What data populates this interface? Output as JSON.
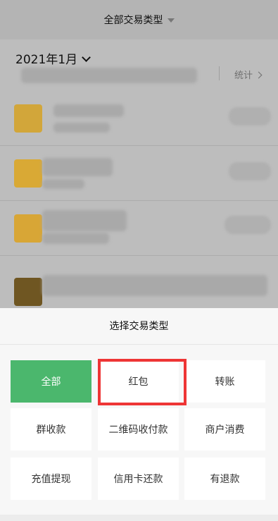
{
  "header": {
    "filter_title": "全部交易类型"
  },
  "month_bar": {
    "month": "2021年1月",
    "stats_label": "统计"
  },
  "records": [
    {
      "name_fragment": "...",
      "icon_color": "#d2a63a"
    },
    {
      "name_fragment": "",
      "icon_color": "#d9a935"
    },
    {
      "name_fragment": "",
      "icon_color": "#d8a636"
    },
    {
      "name_fragment": "",
      "icon_color": "#6f5622"
    }
  ],
  "sheet": {
    "title": "选择交易类型",
    "selected": "全部",
    "highlighted": "红包",
    "options": [
      "全部",
      "红包",
      "转账",
      "群收款",
      "二维码收付款",
      "商户消费",
      "充值提现",
      "信用卡还款",
      "有退款"
    ]
  },
  "colors": {
    "accent_green": "#4bb76d",
    "highlight_red": "#ee3535"
  }
}
